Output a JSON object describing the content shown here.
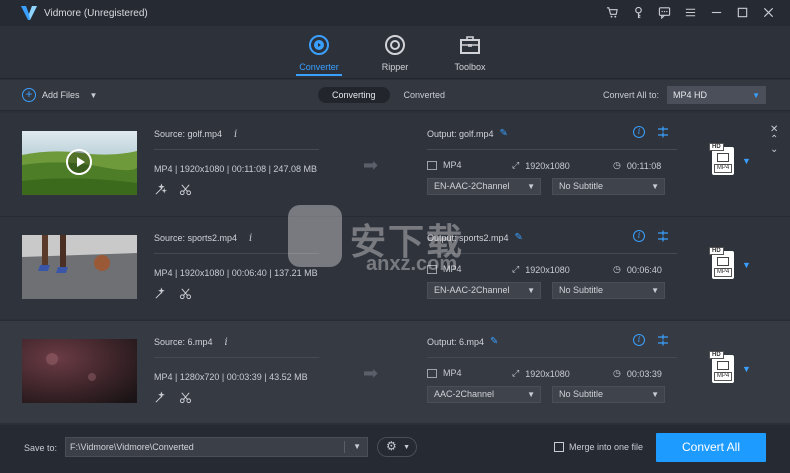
{
  "app": {
    "title": "Vidmore (Unregistered)"
  },
  "window_controls": [
    "cart-icon",
    "key-icon",
    "feedback-icon",
    "menu-icon",
    "minimize-icon",
    "maximize-icon",
    "close-icon"
  ],
  "nav": {
    "items": [
      {
        "label": "Converter",
        "icon": "converter-icon",
        "active": true
      },
      {
        "label": "Ripper",
        "icon": "ripper-icon",
        "active": false
      },
      {
        "label": "Toolbox",
        "icon": "toolbox-icon",
        "active": false
      }
    ]
  },
  "toolbar": {
    "add_files": "Add Files",
    "tabs": [
      "Converting",
      "Converted"
    ],
    "convert_all_to_label": "Convert All to:",
    "convert_all_to_value": "MP4 HD"
  },
  "files": [
    {
      "source": "Source: golf.mp4",
      "meta": "MP4 | 1920x1080 | 00:11:08 | 247.08 MB",
      "output": "Output: golf.mp4",
      "out_format": "MP4",
      "out_resolution": "1920x1080",
      "out_duration": "00:11:08",
      "audio": "EN-AAC-2Channel",
      "subtitle": "No Subtitle",
      "badge": {
        "hd": "HD",
        "format": "MP4"
      }
    },
    {
      "source": "Source: sports2.mp4",
      "meta": "MP4 | 1920x1080 | 00:06:40 | 137.21 MB",
      "output": "Output: sports2.mp4",
      "out_format": "MP4",
      "out_resolution": "1920x1080",
      "out_duration": "00:06:40",
      "audio": "EN-AAC-2Channel",
      "subtitle": "No Subtitle",
      "badge": {
        "hd": "HD",
        "format": "MP4"
      }
    },
    {
      "source": "Source: 6.mp4",
      "meta": "MP4 | 1280x720 | 00:03:39 | 43.52 MB",
      "output": "Output: 6.mp4",
      "out_format": "MP4",
      "out_resolution": "1920x1080",
      "out_duration": "00:03:39",
      "audio": "AAC-2Channel",
      "subtitle": "No Subtitle",
      "badge": {
        "hd": "HD",
        "format": "MP4"
      }
    }
  ],
  "watermark": {
    "text": "安下载",
    "sub": "anxz.com"
  },
  "bottom": {
    "save_to_label": "Save to:",
    "save_path": "F:\\Vidmore\\Vidmore\\Converted",
    "merge_label": "Merge into one file",
    "merge_checked": false,
    "convert_all": "Convert All"
  },
  "colors": {
    "accent": "#1e9bff",
    "background": "#2b2f38"
  }
}
